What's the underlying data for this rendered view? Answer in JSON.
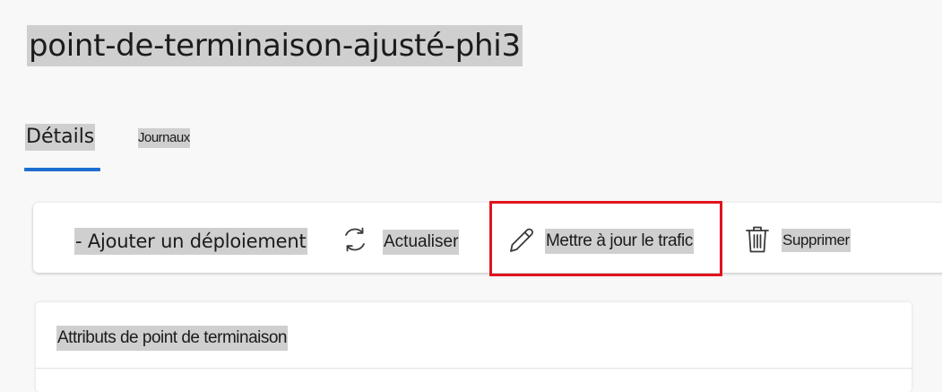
{
  "page": {
    "title": "point-de-terminaison-ajusté-phi3"
  },
  "tabs": [
    {
      "label": "Détails",
      "selected": true
    },
    {
      "label": "Journaux",
      "selected": false
    }
  ],
  "toolbar": {
    "add_deployment_label": "- Ajouter un déploiement",
    "refresh_label": "Actualiser",
    "update_traffic_label": "Mettre à jour le trafic",
    "delete_label": "Supprimer"
  },
  "card": {
    "title": "Attributs de point de terminaison"
  },
  "icons": {
    "refresh": "refresh-icon",
    "edit": "pencil-icon",
    "delete": "trash-icon"
  },
  "colors": {
    "accent": "#1f6fd1",
    "highlight_box": "#e0141e",
    "text_highlight": "#cfcfcf"
  }
}
